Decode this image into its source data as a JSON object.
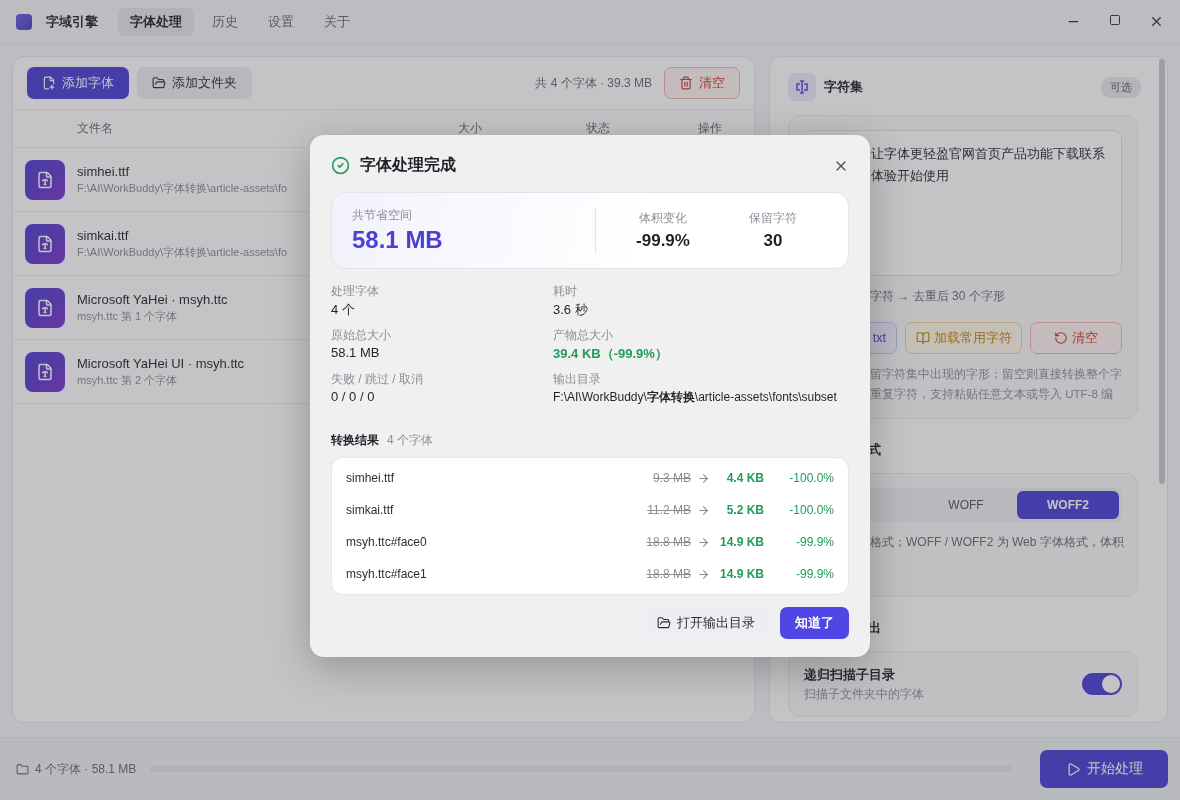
{
  "app": {
    "name": "字域引擎",
    "tabs": [
      {
        "label": "字体处理",
        "selected": true
      },
      {
        "label": "历史",
        "selected": false
      },
      {
        "label": "设置",
        "selected": false
      },
      {
        "label": "关于",
        "selected": false
      }
    ]
  },
  "toolbar": {
    "add_font": "添加字体",
    "add_folder": "添加文件夹",
    "summary": "共 4 个字体 · 39.3 MB",
    "clear": "清空"
  },
  "table": {
    "columns": [
      "文件名",
      "大小",
      "状态",
      "操作"
    ],
    "rows": [
      {
        "name": "simhei.ttf",
        "detail": "F:\\AI\\WorkBuddy\\字体转换\\article-assets\\fo"
      },
      {
        "name": "simkai.ttf",
        "detail": "F:\\AI\\WorkBuddy\\字体转换\\article-assets\\fo"
      },
      {
        "name": "Microsoft YaHei · msyh.ttc",
        "detail": "msyh.ttc 第 1 个字体"
      },
      {
        "name": "Microsoft YaHei UI · msyh.ttc",
        "detail": "msyh.ttc 第 2 个字体"
      }
    ]
  },
  "charset": {
    "title": "字符集",
    "badge": "可选",
    "text": [
      "让字体更轻盈官网首页产品功能下载联系",
      "体验开始使用"
    ],
    "count": "字符 → 去重后 30 个字形",
    "buttons": [
      {
        "label": "txt",
        "kind": "import"
      },
      {
        "label": "加载常用字符",
        "kind": "load"
      },
      {
        "label": "清空",
        "kind": "clear"
      }
    ],
    "help": [
      "留字符集中出现的字形；留空则直接转换整个字",
      "重复字符，支持粘贴任意文本或导入 UTF-8 编"
    ]
  },
  "format": {
    "title": "式",
    "options": [
      {
        "label": "WOFF",
        "selected": false
      },
      {
        "label": "WOFF2",
        "selected": true
      }
    ],
    "help": "格式；WOFF / WOFF2 为 Web 字体格式，体积"
  },
  "output": {
    "title": "出",
    "recursive": {
      "title": "递归扫描子目录",
      "description": "扫描子文件夹中的字体",
      "on": true
    }
  },
  "status_bar": {
    "summary": "4 个字体 · 58.1 MB",
    "progress": {
      "level": 0
    },
    "start": "开始处理"
  },
  "dialog": {
    "title": "字体处理完成",
    "hero": {
      "label": "共节省空间",
      "value": "58.1 MB",
      "stats": [
        {
          "label": "体积变化",
          "value": "-99.9%"
        },
        {
          "label": "保留字符",
          "value": "30"
        }
      ]
    },
    "details": [
      {
        "label": "处理字体",
        "value": "4 个",
        "kind": "plain"
      },
      {
        "label": "耗时",
        "value": "3.6 秒",
        "kind": "plain"
      },
      {
        "label": "原始总大小",
        "value": "58.1 MB",
        "kind": "plain"
      },
      {
        "label": "产物总大小",
        "value": "39.4 KB（-99.9%）",
        "kind": "good"
      },
      {
        "label": "失败 / 跳过 / 取消",
        "value": "0 / 0 / 0",
        "kind": "plain"
      },
      {
        "label": "输出目录",
        "value": "F:\\AI\\WorkBuddy\\**字体转换**\\article-assets\\fonts\\subset",
        "kind": "path"
      }
    ],
    "results_title": "转换结果",
    "results_count": "4 个字体",
    "results": [
      {
        "name": "simhei.ttf",
        "from": "9.3 MB",
        "to": "4.4 KB",
        "change": "-100.0%"
      },
      {
        "name": "simkai.ttf",
        "from": "11.2 MB",
        "to": "5.2 KB",
        "change": "-100.0%"
      },
      {
        "name": "msyh.ttc#face0",
        "from": "18.8 MB",
        "to": "14.9 KB",
        "change": "-99.9%"
      },
      {
        "name": "msyh.ttc#face1",
        "from": "18.8 MB",
        "to": "14.9 KB",
        "change": "-99.9%"
      }
    ],
    "buttons": {
      "open": "打开输出目录",
      "ok": "知道了"
    }
  }
}
